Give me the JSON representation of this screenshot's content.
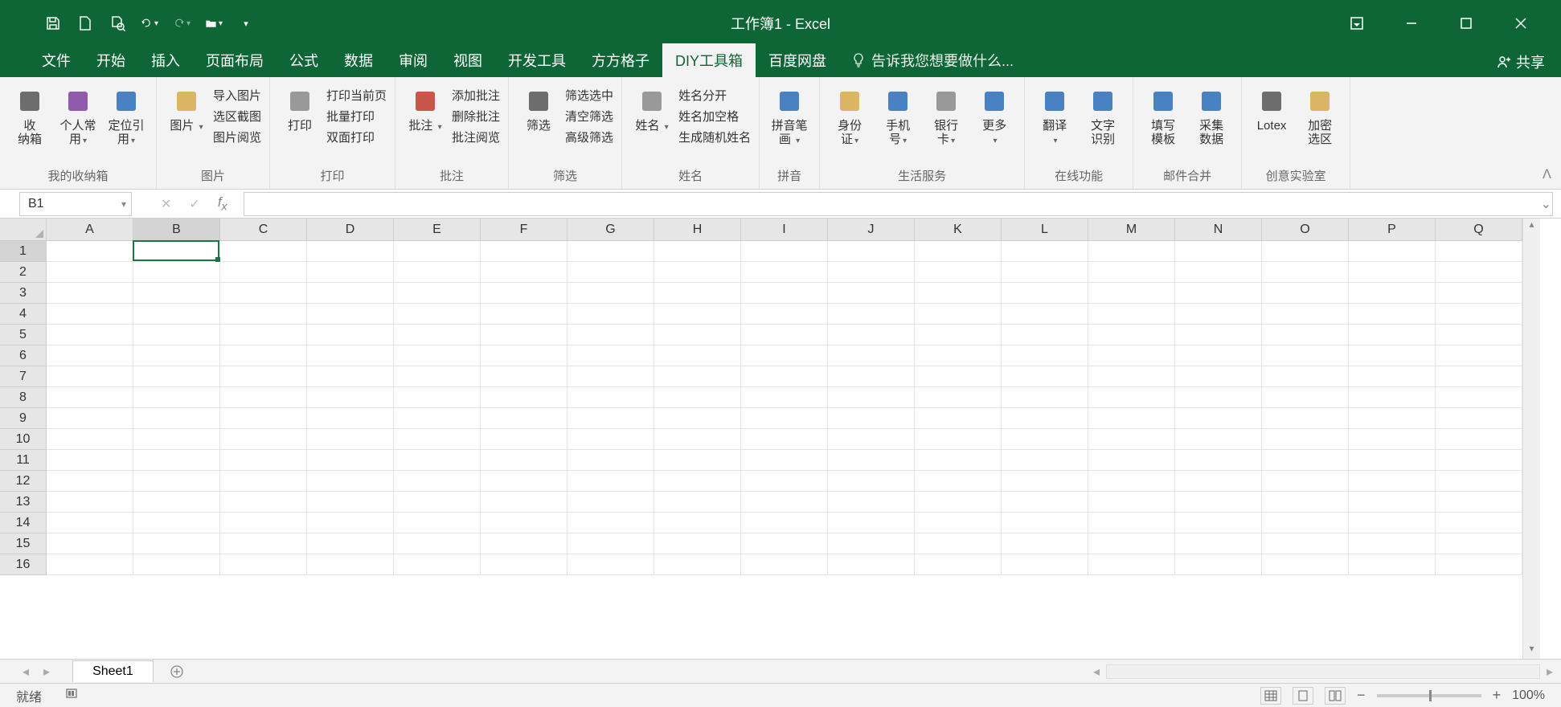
{
  "title": "工作簿1 - Excel",
  "share": "共享",
  "tabs": [
    "文件",
    "开始",
    "插入",
    "页面布局",
    "公式",
    "数据",
    "审阅",
    "视图",
    "开发工具",
    "方方格子",
    "DIY工具箱",
    "百度网盘"
  ],
  "active_tab": "DIY工具箱",
  "tell_me": "告诉我您想要做什么...",
  "ribbon": {
    "g1": {
      "label": "我的收纳箱",
      "btns": [
        {
          "l1": "收",
          "l2": "纳箱"
        },
        {
          "l1": "个人常",
          "l2": "用",
          "dd": true
        },
        {
          "l1": "定位引",
          "l2": "用",
          "dd": true
        }
      ]
    },
    "g2": {
      "label": "图片",
      "big": {
        "l": "图片",
        "dd": true
      },
      "lines": [
        "导入图片",
        "选区截图",
        "图片阅览"
      ]
    },
    "g3": {
      "label": "打印",
      "big": {
        "l": "打印"
      },
      "lines": [
        "打印当前页",
        "批量打印",
        "双面打印"
      ]
    },
    "g4": {
      "label": "批注",
      "big": {
        "l": "批注",
        "dd": true
      },
      "lines": [
        "添加批注",
        "删除批注",
        "批注阅览"
      ]
    },
    "g5": {
      "label": "筛选",
      "big": {
        "l": "筛选"
      },
      "lines": [
        "筛选选中",
        "清空筛选",
        "高级筛选"
      ]
    },
    "g6": {
      "label": "姓名",
      "big": {
        "l": "姓名",
        "dd": true
      },
      "lines": [
        "姓名分开",
        "姓名加空格",
        "生成随机姓名"
      ]
    },
    "g7": {
      "label": "拼音",
      "big": {
        "l1": "拼音笔",
        "l2": "画",
        "dd": true
      }
    },
    "g8": {
      "label": "生活服务",
      "btns": [
        {
          "l1": "身份",
          "l2": "证",
          "dd": true
        },
        {
          "l1": "手机",
          "l2": "号",
          "dd": true
        },
        {
          "l1": "银行",
          "l2": "卡",
          "dd": true
        },
        {
          "l1": "更多",
          "dd": true
        }
      ]
    },
    "g9": {
      "label": "在线功能",
      "btns": [
        {
          "l1": "翻译",
          "dd": true
        },
        {
          "l1": "文字",
          "l2": "识别"
        }
      ]
    },
    "g10": {
      "label": "邮件合并",
      "btns": [
        {
          "l1": "填写",
          "l2": "模板"
        },
        {
          "l1": "采集",
          "l2": "数据"
        }
      ]
    },
    "g11": {
      "label": "创意实验室",
      "btns": [
        {
          "l1": "Lotex"
        },
        {
          "l1": "加密",
          "l2": "选区"
        }
      ]
    }
  },
  "namebox": "B1",
  "columns": [
    "A",
    "B",
    "C",
    "D",
    "E",
    "F",
    "G",
    "H",
    "I",
    "J",
    "K",
    "L",
    "M",
    "N",
    "O",
    "P",
    "Q"
  ],
  "rows": [
    "1",
    "2",
    "3",
    "4",
    "5",
    "6",
    "7",
    "8",
    "9",
    "10",
    "11",
    "12",
    "13",
    "14",
    "15",
    "16"
  ],
  "selected": {
    "row": 0,
    "col": 1
  },
  "sheet": "Sheet1",
  "status": "就绪",
  "zoom": "100%"
}
